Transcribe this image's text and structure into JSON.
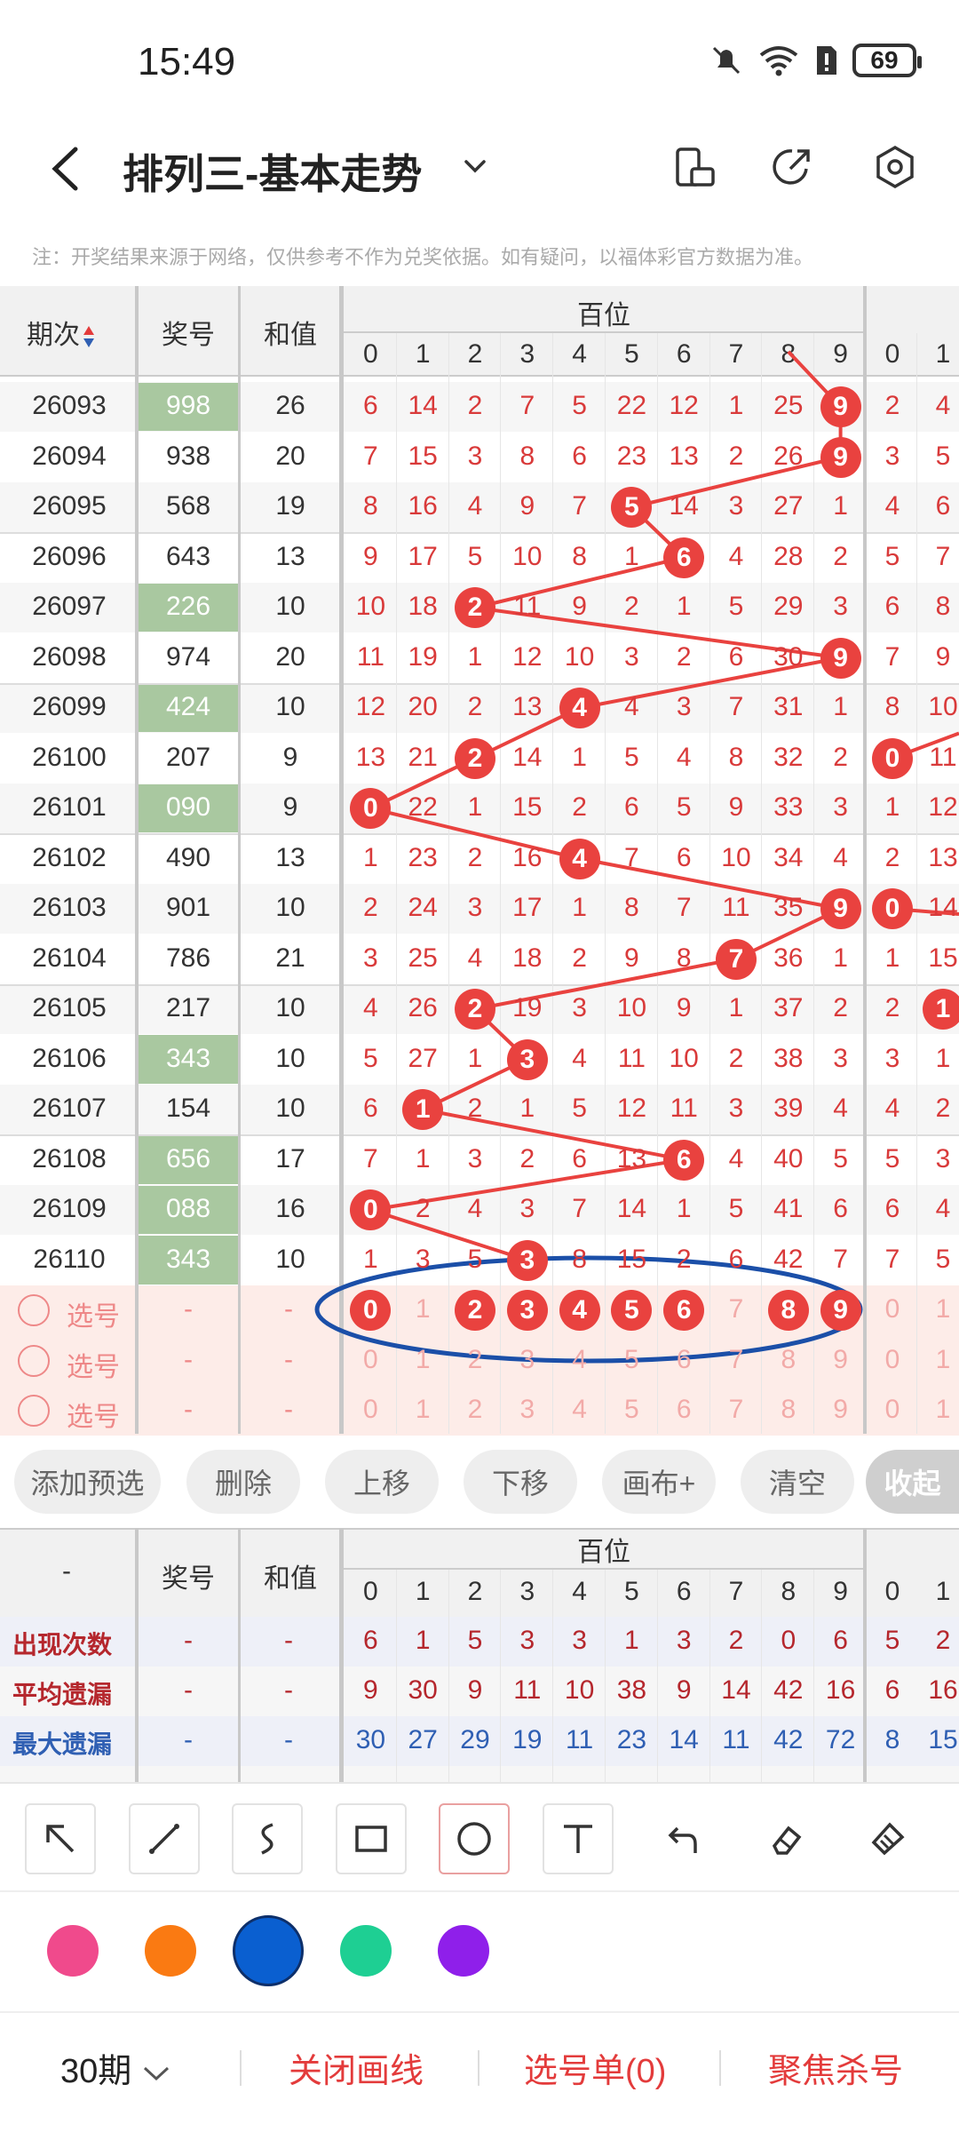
{
  "status": {
    "time": "15:49",
    "battery": "69"
  },
  "header": {
    "title": "排列三-基本走势"
  },
  "note": "注：开奖结果来源于网络，仅供参考不作为兑奖依据。如有疑问，以福体彩官方数据为准。",
  "table": {
    "col_period": "期次",
    "col_number": "奖号",
    "col_sum": "和值",
    "group": "百位",
    "digits": [
      "0",
      "1",
      "2",
      "3",
      "4",
      "5",
      "6",
      "7",
      "8",
      "9"
    ],
    "next_digits": [
      "0",
      "1"
    ],
    "rows": [
      {
        "period": "26093",
        "number": "998",
        "sum": "26",
        "hl": true,
        "cells": [
          "6",
          "14",
          "2",
          "7",
          "5",
          "22",
          "12",
          "1",
          "25",
          "9"
        ],
        "hit": 9,
        "next": [
          "2",
          "4"
        ]
      },
      {
        "period": "26094",
        "number": "938",
        "sum": "20",
        "hl": false,
        "cells": [
          "7",
          "15",
          "3",
          "8",
          "6",
          "23",
          "13",
          "2",
          "26",
          "9"
        ],
        "hit": 9,
        "next": [
          "3",
          "5"
        ]
      },
      {
        "period": "26095",
        "number": "568",
        "sum": "19",
        "hl": false,
        "cells": [
          "8",
          "16",
          "4",
          "9",
          "7",
          "5",
          "14",
          "3",
          "27",
          "1"
        ],
        "hit": 5,
        "next": [
          "4",
          "6"
        ]
      },
      {
        "period": "26096",
        "number": "643",
        "sum": "13",
        "hl": false,
        "cells": [
          "9",
          "17",
          "5",
          "10",
          "8",
          "1",
          "6",
          "4",
          "28",
          "2"
        ],
        "hit": 6,
        "next": [
          "5",
          "7"
        ]
      },
      {
        "period": "26097",
        "number": "226",
        "sum": "10",
        "hl": true,
        "cells": [
          "10",
          "18",
          "2",
          "11",
          "9",
          "2",
          "1",
          "5",
          "29",
          "3"
        ],
        "hit": 2,
        "next": [
          "6",
          "8"
        ]
      },
      {
        "period": "26098",
        "number": "974",
        "sum": "20",
        "hl": false,
        "cells": [
          "11",
          "19",
          "1",
          "12",
          "10",
          "3",
          "2",
          "6",
          "30",
          "9"
        ],
        "hit": 9,
        "next": [
          "7",
          "9"
        ]
      },
      {
        "period": "26099",
        "number": "424",
        "sum": "10",
        "hl": true,
        "cells": [
          "12",
          "20",
          "2",
          "13",
          "4",
          "4",
          "3",
          "7",
          "31",
          "1"
        ],
        "hit": 4,
        "next": [
          "8",
          "10"
        ]
      },
      {
        "period": "26100",
        "number": "207",
        "sum": "9",
        "hl": false,
        "cells": [
          "13",
          "21",
          "2",
          "14",
          "1",
          "5",
          "4",
          "8",
          "32",
          "2"
        ],
        "hit": 2,
        "next": [
          "0",
          "11"
        ]
      },
      {
        "period": "26101",
        "number": "090",
        "sum": "9",
        "hl": true,
        "cells": [
          "0",
          "22",
          "1",
          "15",
          "2",
          "6",
          "5",
          "9",
          "33",
          "3"
        ],
        "hit": 0,
        "next": [
          "1",
          "12"
        ]
      },
      {
        "period": "26102",
        "number": "490",
        "sum": "13",
        "hl": false,
        "cells": [
          "1",
          "23",
          "2",
          "16",
          "4",
          "7",
          "6",
          "10",
          "34",
          "4"
        ],
        "hit": 4,
        "next": [
          "2",
          "13"
        ]
      },
      {
        "period": "26103",
        "number": "901",
        "sum": "10",
        "hl": false,
        "cells": [
          "2",
          "24",
          "3",
          "17",
          "1",
          "8",
          "7",
          "11",
          "35",
          "9"
        ],
        "hit": 9,
        "next": [
          "0",
          "14"
        ]
      },
      {
        "period": "26104",
        "number": "786",
        "sum": "21",
        "hl": false,
        "cells": [
          "3",
          "25",
          "4",
          "18",
          "2",
          "9",
          "8",
          "7",
          "36",
          "1"
        ],
        "hit": 7,
        "next": [
          "1",
          "15"
        ]
      },
      {
        "period": "26105",
        "number": "217",
        "sum": "10",
        "hl": false,
        "cells": [
          "4",
          "26",
          "2",
          "19",
          "3",
          "10",
          "9",
          "1",
          "37",
          "2"
        ],
        "hit": 2,
        "next": [
          "2",
          "1"
        ]
      },
      {
        "period": "26106",
        "number": "343",
        "sum": "10",
        "hl": true,
        "cells": [
          "5",
          "27",
          "1",
          "3",
          "4",
          "11",
          "10",
          "2",
          "38",
          "3"
        ],
        "hit": 3,
        "next": [
          "3",
          "1"
        ]
      },
      {
        "period": "26107",
        "number": "154",
        "sum": "10",
        "hl": false,
        "cells": [
          "6",
          "1",
          "2",
          "1",
          "5",
          "12",
          "11",
          "3",
          "39",
          "4"
        ],
        "hit": 1,
        "next": [
          "4",
          "2"
        ]
      },
      {
        "period": "26108",
        "number": "656",
        "sum": "17",
        "hl": true,
        "cells": [
          "7",
          "1",
          "3",
          "2",
          "6",
          "13",
          "6",
          "4",
          "40",
          "5"
        ],
        "hit": 6,
        "next": [
          "5",
          "3"
        ]
      },
      {
        "period": "26109",
        "number": "088",
        "sum": "16",
        "hl": true,
        "cells": [
          "0",
          "2",
          "4",
          "3",
          "7",
          "14",
          "1",
          "5",
          "41",
          "6"
        ],
        "hit": 0,
        "next": [
          "6",
          "4"
        ]
      },
      {
        "period": "26110",
        "number": "343",
        "sum": "10",
        "hl": true,
        "cells": [
          "1",
          "3",
          "5",
          "3",
          "8",
          "15",
          "2",
          "6",
          "42",
          "7"
        ],
        "hit": 3,
        "next": [
          "7",
          "5"
        ]
      }
    ],
    "select_label": "选号",
    "dash": "-",
    "select_selected": [
      0,
      2,
      3,
      4,
      5,
      6,
      8,
      9
    ]
  },
  "buttons": {
    "add": "添加预选",
    "delete": "删除",
    "up": "上移",
    "down": "下移",
    "canvas": "画布+",
    "clear": "清空",
    "collapse": "收起"
  },
  "stats": {
    "col_dash": "-",
    "col_number": "奖号",
    "col_sum": "和值",
    "group": "百位",
    "rows": [
      {
        "label": "出现次数",
        "values": [
          "6",
          "1",
          "5",
          "3",
          "3",
          "1",
          "3",
          "2",
          "0",
          "6"
        ],
        "next": [
          "5",
          "2"
        ],
        "color": "#b5272d"
      },
      {
        "label": "平均遗漏",
        "values": [
          "9",
          "30",
          "9",
          "11",
          "10",
          "38",
          "9",
          "14",
          "42",
          "16"
        ],
        "next": [
          "6",
          "16"
        ],
        "color": "#b5272d"
      },
      {
        "label": "最大遗漏",
        "values": [
          "30",
          "27",
          "29",
          "19",
          "11",
          "23",
          "14",
          "11",
          "42",
          "72"
        ],
        "next": [
          "8",
          "15"
        ],
        "color": "#2f5fb3"
      }
    ]
  },
  "toolbar": {
    "tools": [
      "arrow-tool-icon",
      "line-tool-icon",
      "curve-tool-icon",
      "rectangle-tool-icon",
      "circle-tool-icon",
      "text-tool-icon",
      "undo-icon",
      "eraser-icon",
      "clear-brush-icon"
    ],
    "selected": "circle-tool-icon"
  },
  "colors": [
    "#f04a8c",
    "#fa7a12",
    "#0a5fd0",
    "#1ecf93",
    "#8f1fea"
  ],
  "bottom": {
    "period": "30期",
    "close_lines": "关闭画线",
    "select_list": "选号单(0)",
    "focus_kill": "聚焦杀号"
  }
}
